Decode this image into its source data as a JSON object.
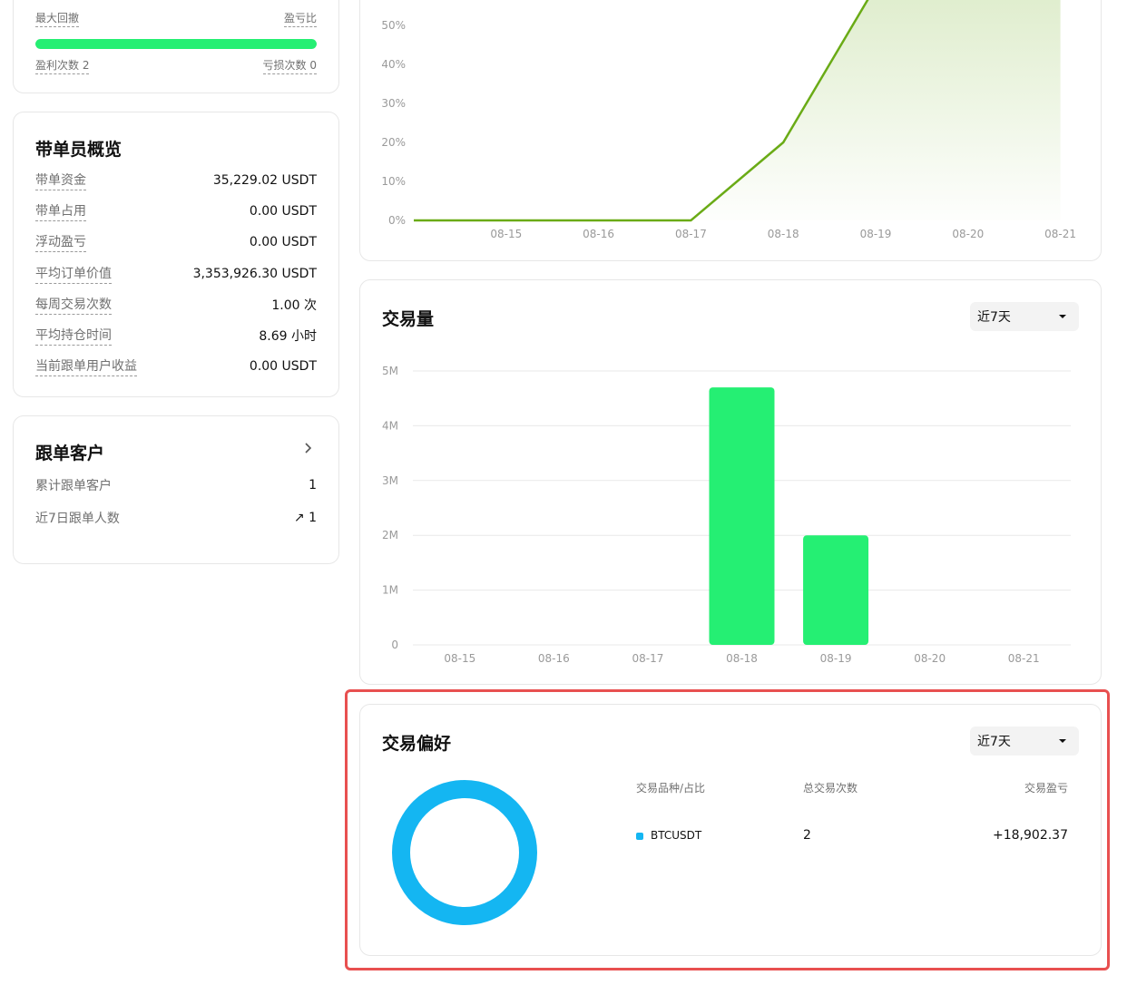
{
  "stats": {
    "max_drawdown_label": "最大回撤",
    "pnl_ratio_label": "盈亏比",
    "win_label": "盈利次数 2",
    "loss_label": "亏损次数 0",
    "win_fraction": 1.0,
    "bar_color": "#25ef73"
  },
  "overview": {
    "title": "带单员概览",
    "rows": [
      {
        "label": "带单资金",
        "value": "35,229.02 USDT"
      },
      {
        "label": "带单占用",
        "value": "0.00 USDT"
      },
      {
        "label": "浮动盈亏",
        "value": "0.00 USDT"
      },
      {
        "label": "平均订单价值",
        "value": "3,353,926.30 USDT"
      },
      {
        "label": "每周交易次数",
        "value": "1.00 次"
      },
      {
        "label": "平均持仓时间",
        "value": "8.69 小时"
      },
      {
        "label": "当前跟单用户收益",
        "value": "0.00 USDT"
      }
    ]
  },
  "followers": {
    "title": "跟单客户",
    "total_label": "累计跟单客户",
    "total_value": "1",
    "recent_label": "近7日跟单人数",
    "recent_value": "↗ 1"
  },
  "volume": {
    "title": "交易量",
    "range_select": "近7天"
  },
  "preference": {
    "title": "交易偏好",
    "range_select": "近7天",
    "headers": {
      "symbol": "交易品种/占比",
      "count": "总交易次数",
      "pnl": "交易盈亏"
    },
    "rows": [
      {
        "symbol": "BTCUSDT",
        "count": "2",
        "pnl": "+18,902.37",
        "share": 1.0,
        "color": "#14b6f2"
      }
    ]
  },
  "colors": {
    "accent_green": "#25ef73",
    "line_green": "#6aab16",
    "positive": "#1fcf63",
    "donut": "#14b6f2",
    "highlight": "#e85050"
  },
  "chart_data": [
    {
      "type": "area",
      "title": "",
      "x": [
        "08-15",
        "08-16",
        "08-17",
        "08-18",
        "08-19",
        "08-20",
        "08-21"
      ],
      "x_start": "08-14",
      "series": [
        {
          "values_x": [
            "08-14",
            "08-15",
            "08-16",
            "08-17",
            "08-18",
            "08-19",
            "08-20",
            "08-21"
          ],
          "values": [
            0,
            0,
            0,
            0,
            20,
            60,
            60,
            60
          ]
        }
      ],
      "ytick_labels": [
        "0%",
        "10%",
        "20%",
        "30%",
        "40%",
        "50%"
      ],
      "ylim": [
        0,
        50
      ],
      "grid": false
    },
    {
      "type": "bar",
      "title": "",
      "categories": [
        "08-15",
        "08-16",
        "08-17",
        "08-18",
        "08-19",
        "08-20",
        "08-21"
      ],
      "values": [
        0,
        0,
        0,
        4700000,
        2000000,
        0,
        0
      ],
      "ytick_labels": [
        "0",
        "1M",
        "2M",
        "3M",
        "4M",
        "5M"
      ],
      "ylim": [
        0,
        5000000
      ],
      "grid": true
    },
    {
      "type": "pie",
      "title": "",
      "labels": [
        "BTCUSDT"
      ],
      "values": [
        1.0
      ],
      "donut": true
    }
  ]
}
